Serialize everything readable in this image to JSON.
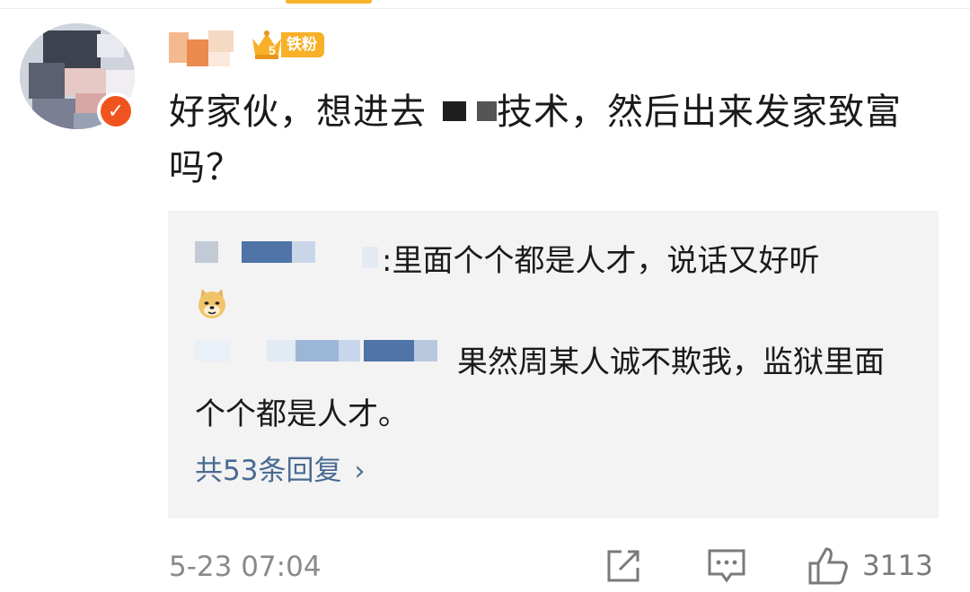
{
  "comment": {
    "fan_badge": "铁粉",
    "fan_level": "5",
    "text_before": "好家伙，想进去",
    "text_after": "技术，然后出来发家致富吗？",
    "timestamp": "5-23 07:04",
    "like_count": "3113"
  },
  "replies": [
    {
      "separator": ":",
      "text": "里面个个都是人才，说话又好听",
      "emoji": "doge-emoji"
    },
    {
      "text": "果然周某人诚不欺我，监狱里面个个都是人才。"
    }
  ],
  "more_replies_label": "共53条回复",
  "icons": {
    "share": "share-icon",
    "comment": "comment-icon",
    "like": "thumbs-up-icon",
    "verified": "verified-badge-icon",
    "crown": "crown-icon",
    "chevron": "chevron-right-icon"
  },
  "colors": {
    "fan_badge": "#f7b027",
    "verified": "#f0541e",
    "link": "#4a6a91",
    "reply_bg": "#f3f3f3"
  }
}
